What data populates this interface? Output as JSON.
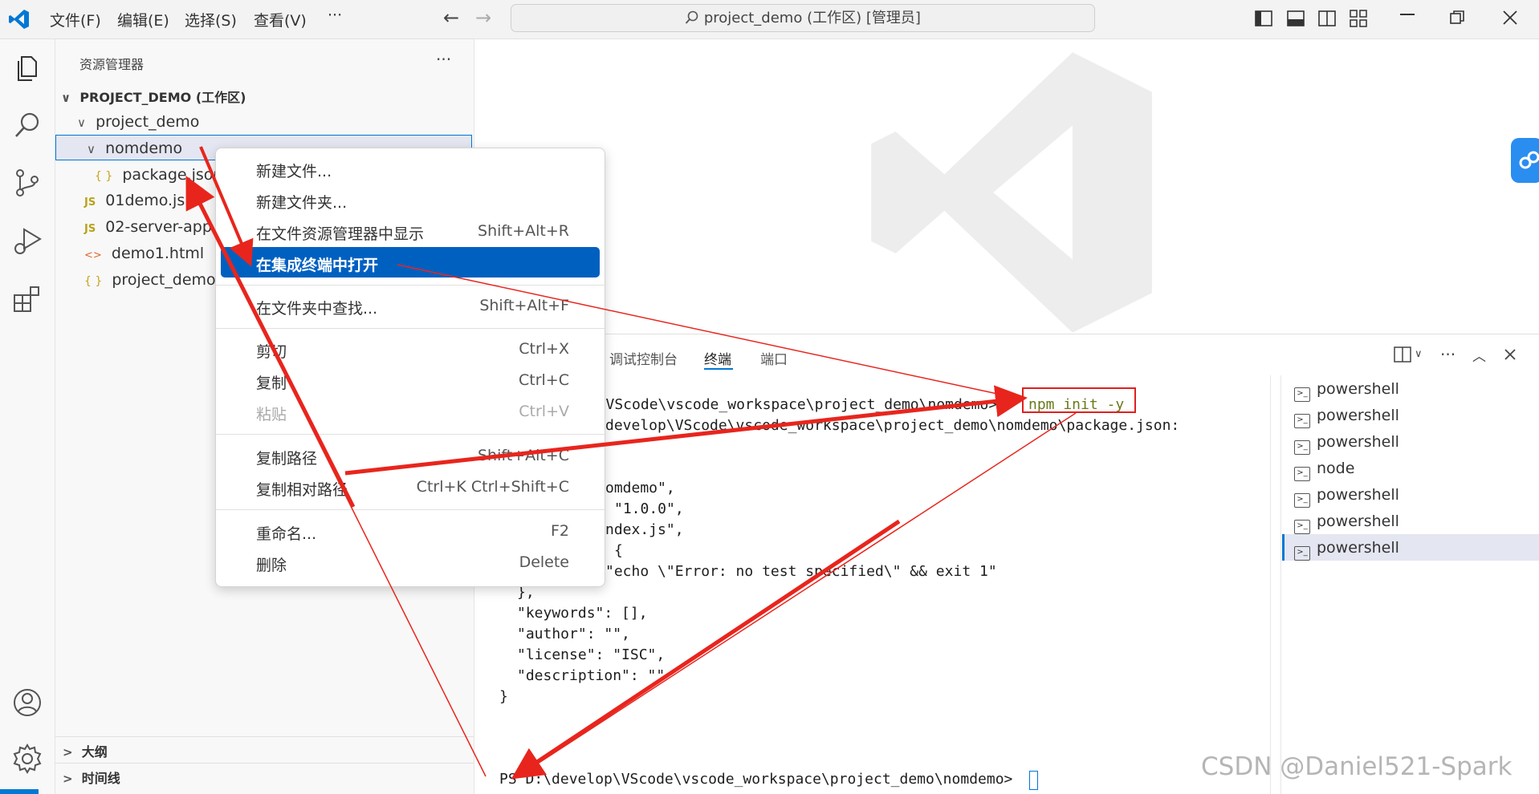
{
  "menubar": {
    "items": [
      "文件(F)",
      "编辑(E)",
      "选择(S)",
      "查看(V)"
    ],
    "more": "···",
    "title": "project_demo (工作区) [管理员]"
  },
  "sidebar": {
    "title": "资源管理器",
    "more": "···",
    "workspace": "PROJECT_DEMO (工作区)",
    "folder": "project_demo",
    "selected_folder": "nomdemo",
    "files": [
      {
        "icon": "{ }",
        "name": "package.json"
      },
      {
        "icon": "JS",
        "name": "01demo.js"
      },
      {
        "icon": "JS",
        "name": "02-server-app.js"
      },
      {
        "icon": "<>",
        "name": "demo1.html"
      },
      {
        "icon": "{ }",
        "name": "project_demo.code-workspace"
      }
    ],
    "outline": "大纲",
    "timeline": "时间线"
  },
  "context_menu": {
    "items": [
      {
        "label": "新建文件...",
        "key": ""
      },
      {
        "label": "新建文件夹...",
        "key": ""
      },
      {
        "label": "在文件资源管理器中显示",
        "key": "Shift+Alt+R"
      },
      {
        "label": "在集成终端中打开",
        "key": ""
      },
      {
        "label": "在文件夹中查找...",
        "key": "Shift+Alt+F"
      },
      {
        "label": "剪切",
        "key": "Ctrl+X"
      },
      {
        "label": "复制",
        "key": "Ctrl+C"
      },
      {
        "label": "粘贴",
        "key": "Ctrl+V"
      },
      {
        "label": "复制路径",
        "key": "Shift+Alt+C"
      },
      {
        "label": "复制相对路径",
        "key": "Ctrl+K Ctrl+Shift+C"
      },
      {
        "label": "重命名...",
        "key": "F2"
      },
      {
        "label": "删除",
        "key": "Delete"
      }
    ]
  },
  "panel": {
    "tabs": [
      "调试控制台",
      "终端",
      "端口"
    ],
    "terminal_lines": [
      "op\\VScode\\vscode_workspace\\project_demo\\nomdemo>",
      "develop\\VScode\\vscode_workspace\\project_demo\\nomdemo\\package.json:",
      "omdemo\",",
      "\"1.0.0\",",
      "ndex.js\",",
      "{",
      "\"echo \\\"Error: no test specified\\\" && exit 1\"",
      "},",
      "\"keywords\": [],",
      "\"author\": \"\",",
      "\"license\": \"ISC\",",
      "\"description\": \"\"",
      "}"
    ],
    "command": "npm init -y",
    "prompt": "PS D:\\develop\\VScode\\vscode_workspace\\project_demo\\nomdemo>",
    "terminals": [
      "powershell",
      "powershell",
      "powershell",
      "node",
      "powershell",
      "powershell",
      "powershell"
    ]
  },
  "watermark": "CSDN @Daniel521-Spark",
  "colors": {
    "accent": "#0060c0",
    "annotation": "#e8251d"
  }
}
